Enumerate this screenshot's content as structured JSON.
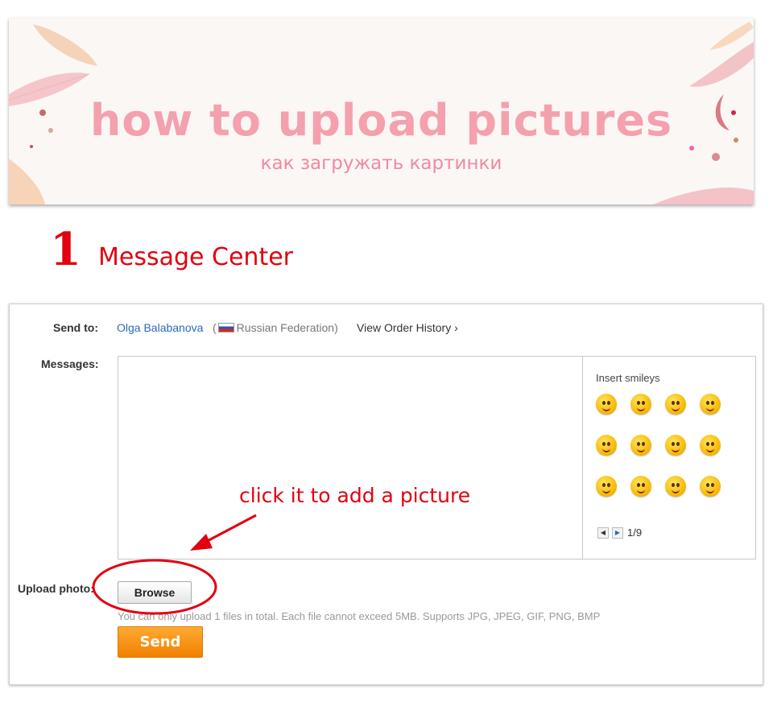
{
  "banner": {
    "title": "how to upload pictures",
    "subtitle": "как загружать картинки"
  },
  "step": {
    "number": "1",
    "title": "Message Center"
  },
  "form": {
    "send_to_label": "Send to:",
    "recipient_name": "Olga Balabanova",
    "recipient_country_prefix": "(",
    "recipient_country": "Russian Federation)",
    "view_history_label": "View Order History ›",
    "messages_label": "Messages:",
    "smileys": {
      "title": "Insert smileys",
      "page_indicator": "1/9",
      "count": 12
    },
    "upload_label": "Upload photo:",
    "browse_label": "Browse",
    "upload_note": "You can only upload 1 files in total. Each file cannot exceed 5MB. Supports JPG, JPEG, GIF, PNG, BMP",
    "send_label": "Send"
  },
  "annotation": {
    "text": "click it to add a picture"
  },
  "colors": {
    "banner_text": "#f4a1ad",
    "step_red": "#e3000f",
    "link_blue": "#2a6bb5",
    "send_orange": "#f59a1e"
  }
}
